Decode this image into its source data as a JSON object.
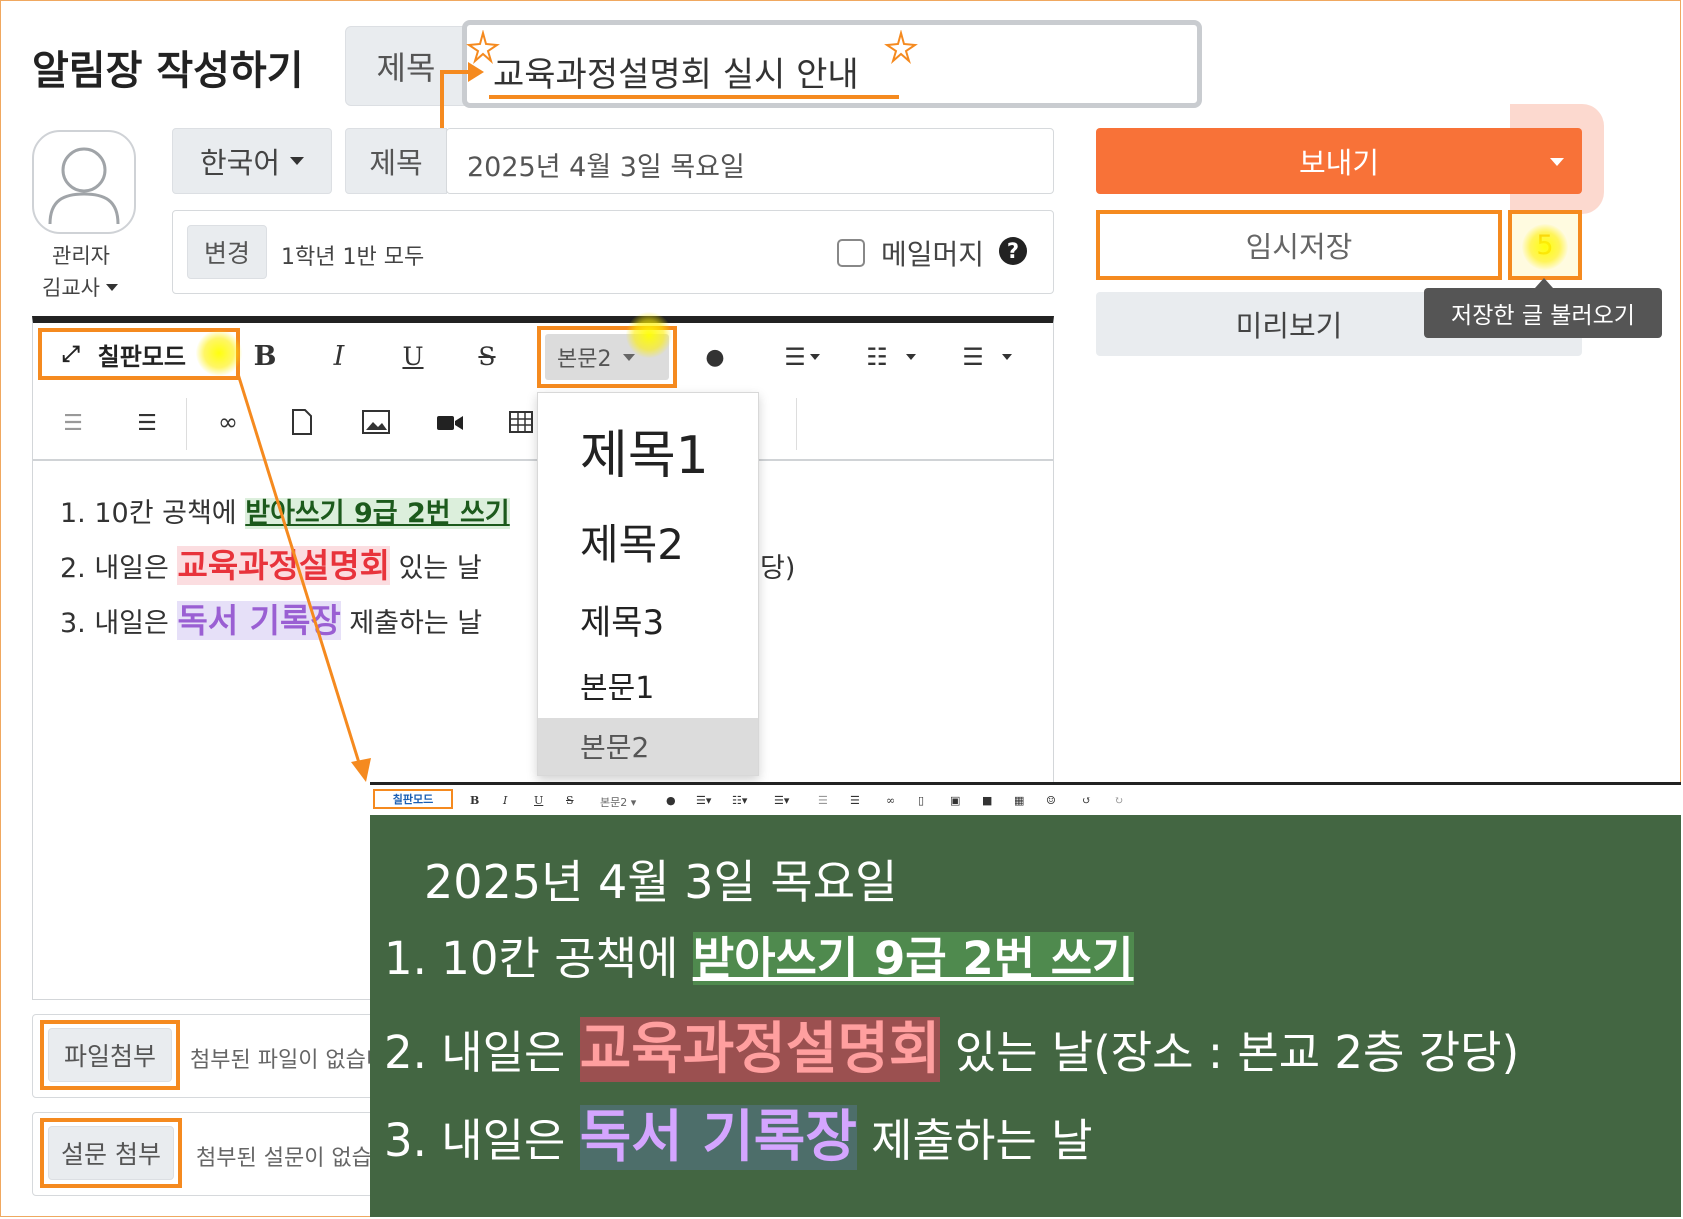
{
  "page_title": "알림장 작성하기",
  "title_field": {
    "label": "제목",
    "value": "교육과정설명회 실시 안내"
  },
  "author": {
    "role": "관리자",
    "name": "김교사"
  },
  "language": {
    "selected": "한국어"
  },
  "subtitle_field": {
    "label": "제목",
    "value": "2025년 4월 3일 목요일"
  },
  "recipients": {
    "change_label": "변경",
    "value": "1학년 1반 모두",
    "mail_merge_label": "메일머지"
  },
  "actions": {
    "send_label": "보내기",
    "save_draft_label": "임시저장",
    "draft_count": "5",
    "preview_label": "미리보기",
    "load_tooltip": "저장한 글 불러오기"
  },
  "toolbar": {
    "blackboard_label": "칠판모드",
    "bold": "B",
    "italic": "I",
    "underline": "U",
    "strike": "S",
    "style_label": "본문2"
  },
  "style_menu": {
    "items": [
      "제목1",
      "제목2",
      "제목3",
      "본문1",
      "본문2"
    ],
    "selected": "본문2"
  },
  "editor": {
    "line1_prefix": "1. 10칸 공책에 ",
    "line1_hl": "받아쓰기 9급 2번 쓰기",
    "line2_prefix": "2. 내일은 ",
    "line2_hl": "교육과정설명회",
    "line2_suffix": " 있는 날",
    "line2_tail": "당)",
    "line3_prefix": "3. 내일은 ",
    "line3_hl": "독서 기록장",
    "line3_suffix": " 제출하는 날"
  },
  "attachments": {
    "file_button": "파일첨부",
    "file_empty": "첨부된 파일이 없습니다",
    "survey_button": "설문 첨부",
    "survey_empty": "첨부된 설문이 없습니다"
  },
  "blackboard_preview": {
    "toolbar_label": "칠판모드",
    "mini_style_label": "본문2",
    "date_line": "2025년 4월 3일 목요일",
    "line1_prefix": "1. 10칸 공책에 ",
    "line1_hl": "받아쓰기 9급 2번 쓰기",
    "line2_prefix": "2. 내일은 ",
    "line2_hl": "교육과정설명회",
    "line2_suffix": " 있는 날(장소 : 본교 2층 강당)",
    "line3_prefix": "3. 내일은 ",
    "line3_hl": "독서 기록장",
    "line3_suffix": " 제출하는 날"
  },
  "colors": {
    "accent_orange": "#f87238",
    "annotation_orange": "#f58a1f",
    "blackboard_green": "#436642",
    "highlight_red_text": "#e8333b",
    "highlight_purple_text": "#9a5fd3"
  }
}
